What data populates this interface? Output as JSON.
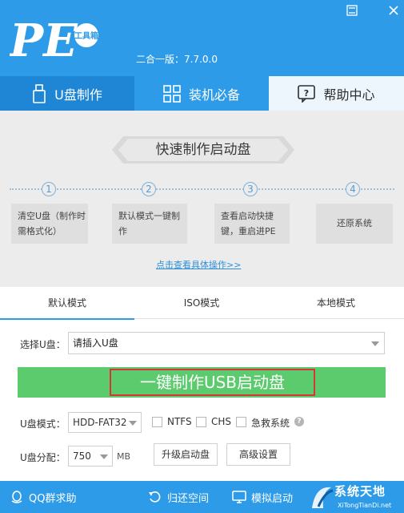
{
  "header": {
    "version": "二合一版：7.7.0.0",
    "logo_text": "PE",
    "logo_badge": "工具箱"
  },
  "nav": {
    "tabs": [
      {
        "label": "U盘制作",
        "icon": "usb-drive-icon"
      },
      {
        "label": "装机必备",
        "icon": "grid-icon"
      },
      {
        "label": "帮助中心",
        "icon": "help-icon"
      }
    ]
  },
  "tutorial": {
    "title": "快速制作启动盘",
    "steps": [
      {
        "num": "1",
        "text": "清空U盘（制作时需格式化）"
      },
      {
        "num": "2",
        "text": "默认模式一键制作"
      },
      {
        "num": "3",
        "text": "查看启动快捷键，重启进PE"
      },
      {
        "num": "4",
        "text": "还原系统"
      }
    ],
    "detail_link": "点击查看具体操作>>"
  },
  "modes": {
    "tabs": [
      "默认模式",
      "ISO模式",
      "本地模式"
    ],
    "active": 0
  },
  "form": {
    "select_label": "选择U盘：",
    "select_value": "请插入U盘",
    "make_button": "一键制作USB启动盘",
    "mode_label": "U盘模式：",
    "fs_value": "HDD-FAT32",
    "options": [
      "NTFS",
      "CHS",
      "急救系统"
    ],
    "partition_label": "U盘分配：",
    "partition_value": "750",
    "partition_unit": "MB",
    "upgrade_button": "升级启动盘",
    "advanced_button": "高级设置"
  },
  "footer": {
    "items": [
      {
        "label": "QQ群求助",
        "icon": "qq-icon"
      },
      {
        "label": "归还空间",
        "icon": "restore-icon"
      },
      {
        "label": "模拟启动",
        "icon": "monitor-icon"
      }
    ],
    "brand_name": "系统天地",
    "brand_url": "XiTongTianDi.net"
  },
  "colors": {
    "primary": "#2e9be8",
    "green": "#5bcb6e",
    "highlight": "#d9343a"
  }
}
